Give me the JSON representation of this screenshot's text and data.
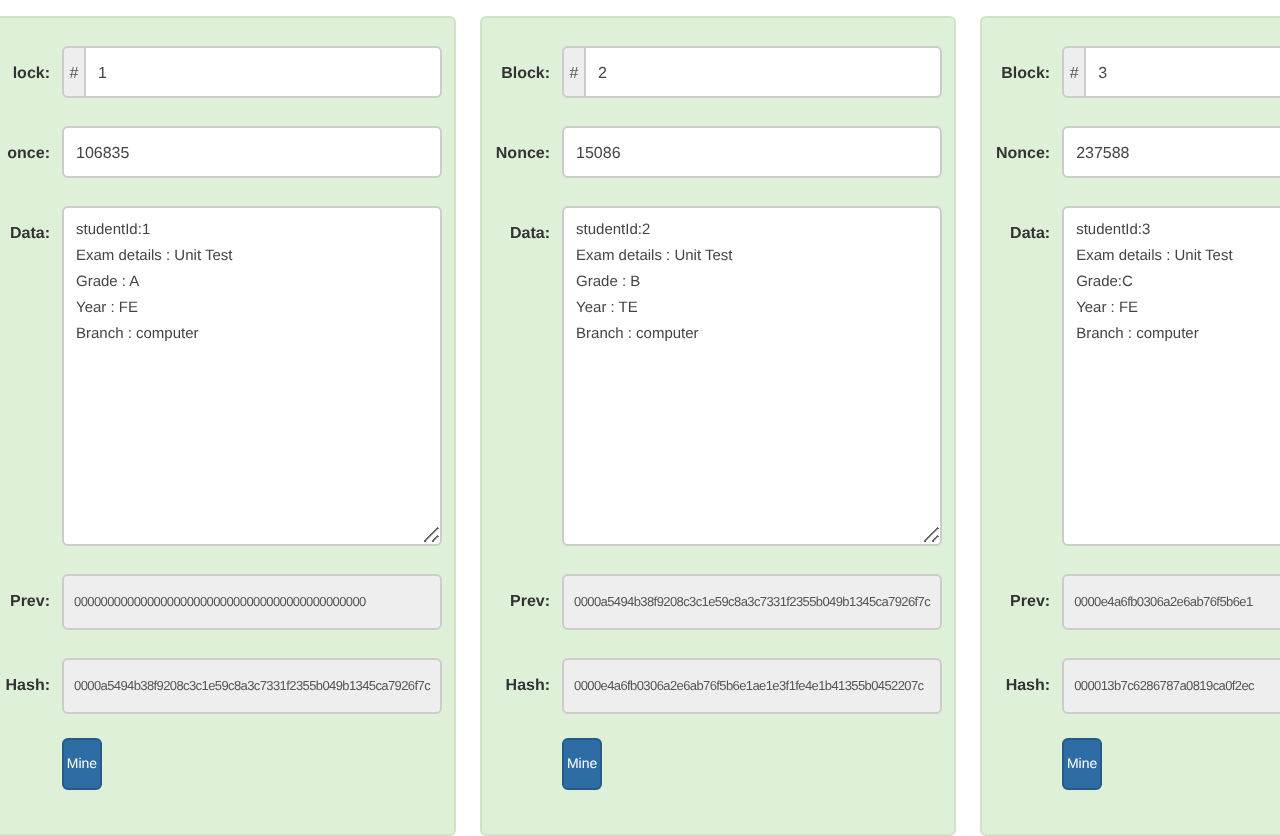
{
  "blocks": [
    {
      "block_label": "lock:",
      "block_prefix": "#",
      "block": "1",
      "nonce_label": "once:",
      "nonce": "106835",
      "data_label": "Data:",
      "data": [
        "studentId:1",
        "Exam details : Unit Test",
        "Grade : A",
        "Year : FE",
        "Branch : computer"
      ],
      "prev_label": "Prev:",
      "prev": "00000000000000000000000000000000000000000000",
      "hash_label": "Hash:",
      "hash": "0000a5494b38f9208c3c1e59c8a3c7331f2355b049b1345ca7926f7c",
      "button": "Mine"
    },
    {
      "block_label": "Block:",
      "block_prefix": "#",
      "block": "2",
      "nonce_label": "Nonce:",
      "nonce": "15086",
      "data_label": "Data:",
      "data": [
        "studentId:2",
        "Exam details : Unit Test",
        "Grade : B",
        "Year : TE",
        "Branch : computer"
      ],
      "prev_label": "Prev:",
      "prev": "0000a5494b38f9208c3c1e59c8a3c7331f2355b049b1345ca7926f7c",
      "hash_label": "Hash:",
      "hash": "0000e4a6fb0306a2e6ab76f5b6e1ae1e3f1fe4e1b41355b0452207c",
      "button": "Mine"
    },
    {
      "block_label": "Block:",
      "block_prefix": "#",
      "block": "3",
      "nonce_label": "Nonce:",
      "nonce": "237588",
      "data_label": "Data:",
      "data": [
        "studentId:3",
        "Exam details : Unit Test",
        "Grade:C",
        "Year : FE",
        "Branch : computer"
      ],
      "prev_label": "Prev:",
      "prev": "0000e4a6fb0306a2e6ab76f5b6e1",
      "hash_label": "Hash:",
      "hash": "000013b7c6286787a0819ca0f2ec",
      "button": "Mine"
    }
  ]
}
